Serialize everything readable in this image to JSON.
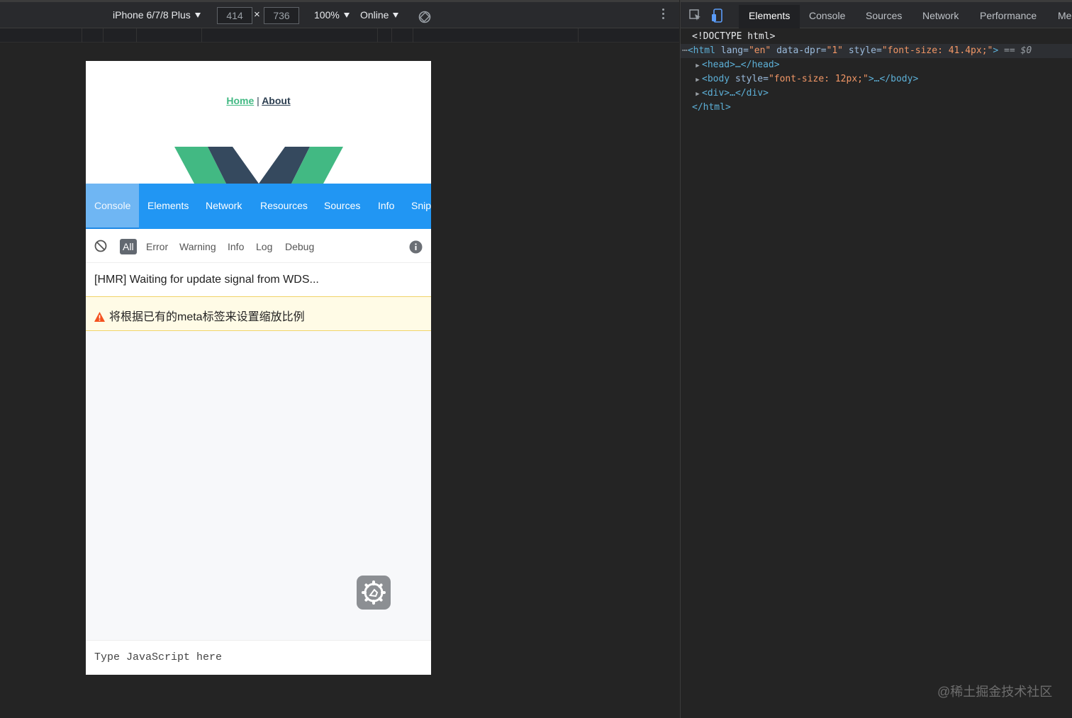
{
  "device_toolbar": {
    "device": "iPhone 6/7/8 Plus",
    "width": "414",
    "height": "736",
    "times": "×",
    "zoom": "100%",
    "throttle": "Online"
  },
  "app": {
    "nav": {
      "home": "Home",
      "separator": "|",
      "about": "About"
    },
    "vconsole_tabs": [
      "Console",
      "Elements",
      "Network",
      "Resources",
      "Sources",
      "Info",
      "Snip"
    ],
    "filters": [
      "All",
      "Error",
      "Warning",
      "Info",
      "Log",
      "Debug"
    ],
    "logs": [
      {
        "level": "log",
        "text": "[HMR] Waiting for update signal from WDS..."
      },
      {
        "level": "warn",
        "text": "将根据已有的meta标签来设置缩放比例"
      }
    ],
    "command_placeholder": "Type JavaScript here"
  },
  "devtools": {
    "tabs": [
      "Elements",
      "Console",
      "Sources",
      "Network",
      "Performance",
      "Me"
    ],
    "dom": {
      "doctype": "<!DOCTYPE html>",
      "html_open_tag": "<html",
      "html_attrs": [
        {
          "name": "lang",
          "value": "\"en\""
        },
        {
          "name": "data-dpr",
          "value": "\"1\""
        },
        {
          "name": "style",
          "value": "\"font-size: 41.4px;\""
        }
      ],
      "selected_marker": "== $0",
      "head": "<head>…</head>",
      "body_open": "<body",
      "body_style_name": "style",
      "body_style_value": "\"font-size: 12px;\"",
      "body_close": ">…</body>",
      "div": "<div>…</div>",
      "html_close": "</html>"
    }
  },
  "watermark": "@稀土掘金技术社区",
  "colors": {
    "vconsole_tab_bar": "#2196f3",
    "vue_green": "#42b983",
    "vue_dark": "#35495e",
    "warn_bg": "#fffbe6"
  }
}
